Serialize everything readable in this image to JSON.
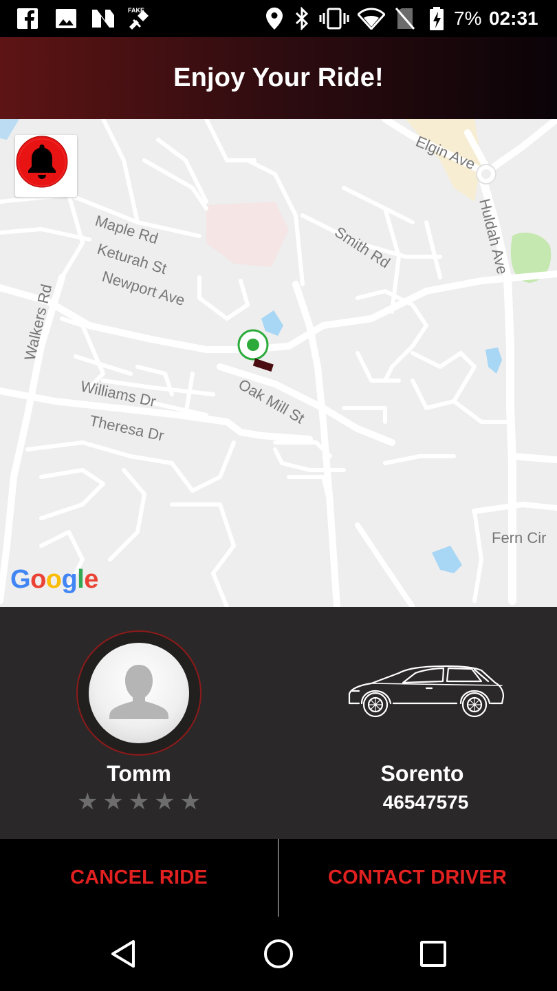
{
  "status_bar": {
    "battery_percent": "7%",
    "time": "02:31",
    "icons": [
      "facebook-icon",
      "image-icon",
      "n-app-icon",
      "fake-gps-icon",
      "location-icon",
      "bluetooth-icon",
      "vibrate-icon",
      "wifi-icon",
      "no-sim-icon",
      "battery-charging-icon"
    ]
  },
  "header": {
    "title": "Enjoy Your Ride!"
  },
  "map": {
    "streets": [
      "Elgin Ave",
      "Huldah Ave",
      "Maple Rd",
      "Keturah St",
      "Newport Ave",
      "Smith Rd",
      "Walkers Rd",
      "Williams Dr",
      "Oak Mill St",
      "Theresa Dr",
      "Fern Cir"
    ],
    "provider_logo": [
      "G",
      "o",
      "o",
      "g",
      "l",
      "e"
    ],
    "alarm_icon": "bell-icon",
    "colors": {
      "background": "#eeeeee",
      "road": "#ffffff",
      "water": "#a8d6f5",
      "park": "#c5e8b0",
      "marker": "#2cab3b"
    }
  },
  "driver": {
    "name": "Tomm",
    "rating": 0,
    "rating_max": 5,
    "star_glyph": "★"
  },
  "car": {
    "model": "Sorento",
    "plate": "46547575",
    "icon": "car-icon"
  },
  "actions": {
    "cancel_label": "CANCEL RIDE",
    "contact_label": "CONTACT DRIVER",
    "accent_color": "#e12020"
  },
  "nav_bar": {
    "icons": [
      "back-icon",
      "home-icon",
      "recents-icon"
    ]
  }
}
